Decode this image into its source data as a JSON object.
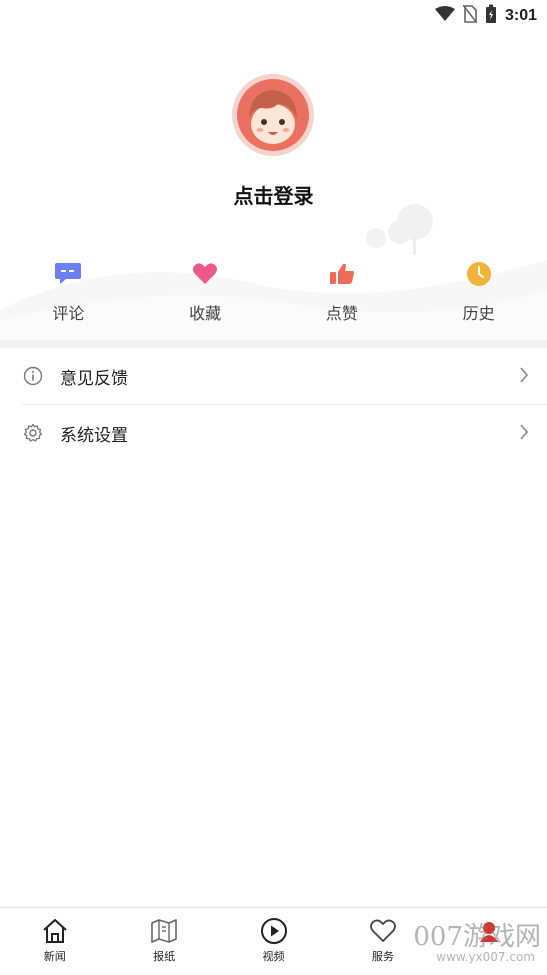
{
  "status_bar": {
    "time": "3:01",
    "icons": [
      "wifi-icon",
      "no-sim-icon",
      "battery-charging-icon"
    ]
  },
  "profile": {
    "login_text": "点击登录",
    "avatar_icon": "cartoon-avatar-icon"
  },
  "actions": [
    {
      "label": "评论",
      "icon": "comment-icon",
      "color": "#6c7ff0"
    },
    {
      "label": "收藏",
      "icon": "heart-icon",
      "color": "#ec5a8b"
    },
    {
      "label": "点赞",
      "icon": "thumbs-up-icon",
      "color": "#f06a5a"
    },
    {
      "label": "历史",
      "icon": "clock-icon",
      "color": "#f0b43a"
    }
  ],
  "menu": [
    {
      "label": "意见反馈",
      "icon": "info-icon"
    },
    {
      "label": "系统设置",
      "icon": "gear-icon"
    }
  ],
  "tabbar": [
    {
      "label": "新闻",
      "icon": "home-icon"
    },
    {
      "label": "报纸",
      "icon": "newspaper-map-icon"
    },
    {
      "label": "视频",
      "icon": "play-icon"
    },
    {
      "label": "服务",
      "icon": "heart-outline-icon"
    },
    {
      "label": "",
      "icon": "mine-icon"
    }
  ],
  "watermark": {
    "text": "007游戏网",
    "url": "www.yx007.com"
  }
}
